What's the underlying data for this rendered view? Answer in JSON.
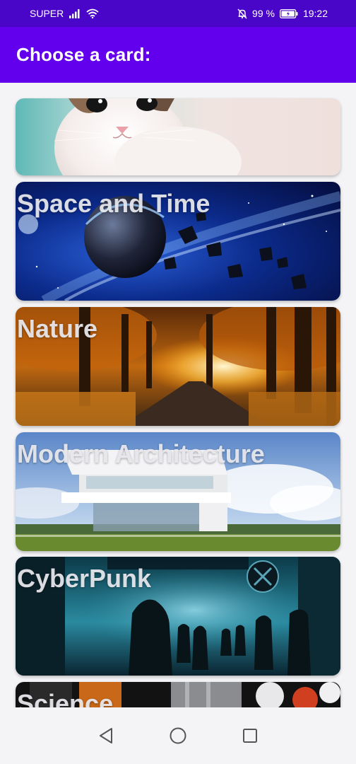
{
  "status_bar": {
    "carrier": "SUPER",
    "battery": "99 %",
    "time": "19:22",
    "icons": [
      "signal-icon",
      "wifi-icon",
      "muted-bell-icon",
      "battery-icon"
    ]
  },
  "app_bar": {
    "title": "Choose a card:"
  },
  "cards": [
    {
      "label": "",
      "image": "kitten-image"
    },
    {
      "label": "Space and Time",
      "image": "space-planet-image"
    },
    {
      "label": "Nature",
      "image": "autumn-forest-image"
    },
    {
      "label": "Modern Architecture",
      "image": "modern-house-image"
    },
    {
      "label": "CyberPunk",
      "image": "cyberpunk-street-image"
    },
    {
      "label": "Science",
      "image": "science-lab-image"
    }
  ],
  "nav_bar": {
    "icons": [
      "back-icon",
      "home-icon",
      "recents-icon"
    ]
  },
  "colors": {
    "status_bar": "#4a06c8",
    "app_bar": "#6200ee",
    "background": "#f4f4f6",
    "card_label": "#ebebf0"
  }
}
